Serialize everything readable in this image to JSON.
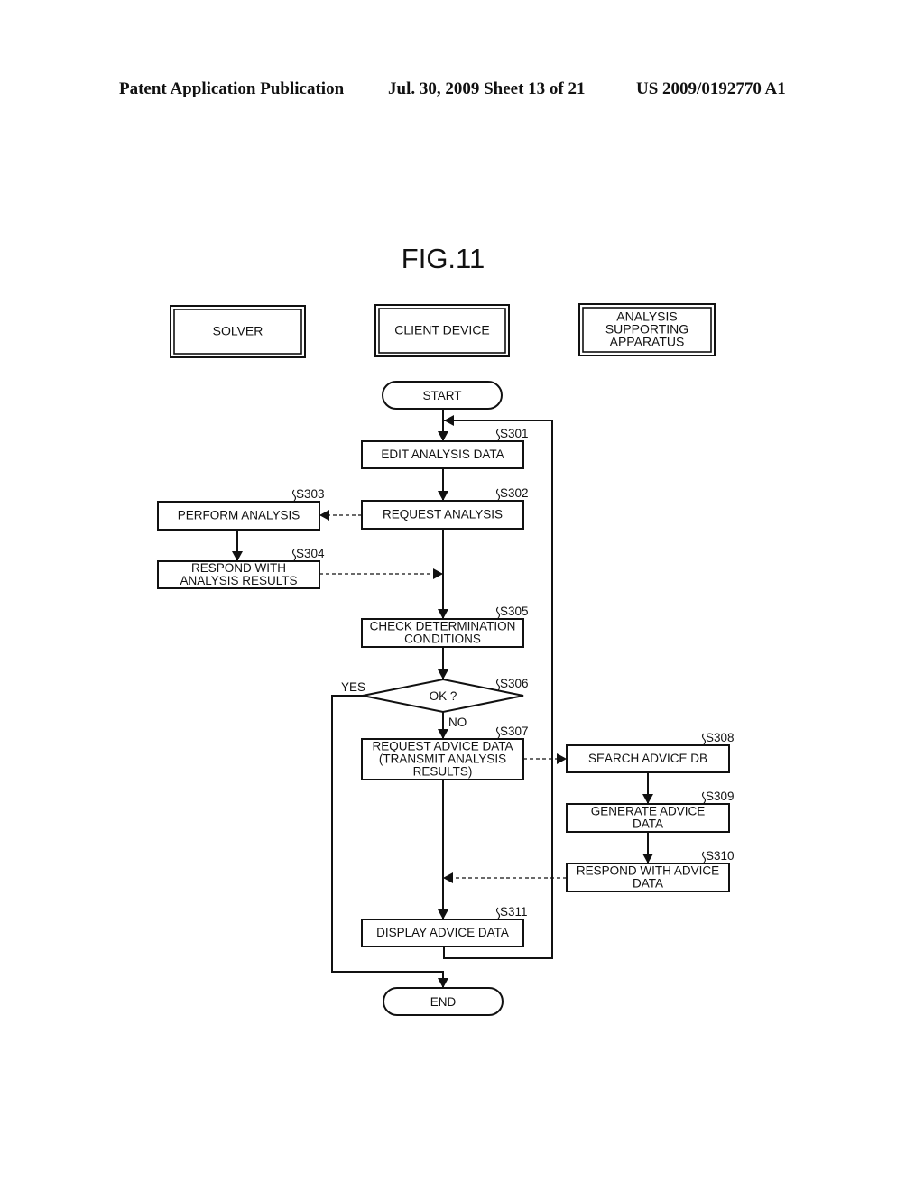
{
  "header": {
    "publication": "Patent Application Publication",
    "date_sheet": "Jul. 30, 2009   Sheet 13 of 21",
    "number": "US 2009/0192770 A1"
  },
  "figure": {
    "title": "FIG.11",
    "lanes": [
      {
        "id": "solver",
        "lines": [
          "SOLVER"
        ]
      },
      {
        "id": "client",
        "lines": [
          "CLIENT DEVICE"
        ]
      },
      {
        "id": "analysis",
        "lines": [
          "ANALYSIS",
          "SUPPORTING",
          "APPARATUS"
        ]
      }
    ],
    "terminals": {
      "start": "START",
      "end": "END"
    },
    "steps": [
      {
        "id": "S301",
        "label": "S301",
        "lines": [
          "EDIT ANALYSIS DATA"
        ]
      },
      {
        "id": "S302",
        "label": "S302",
        "lines": [
          "REQUEST ANALYSIS"
        ]
      },
      {
        "id": "S303",
        "label": "S303",
        "lines": [
          "PERFORM ANALYSIS"
        ]
      },
      {
        "id": "S304",
        "label": "S304",
        "lines": [
          "RESPOND WITH",
          "ANALYSIS RESULTS"
        ]
      },
      {
        "id": "S305",
        "label": "S305",
        "lines": [
          "CHECK DETERMINATION",
          "CONDITIONS"
        ]
      },
      {
        "id": "S306",
        "label": "S306",
        "lines": [
          "OK ?"
        ]
      },
      {
        "id": "S307",
        "label": "S307",
        "lines": [
          "REQUEST ADVICE DATA",
          "(TRANSMIT ANALYSIS",
          "RESULTS)"
        ]
      },
      {
        "id": "S308",
        "label": "S308",
        "lines": [
          "SEARCH ADVICE DB"
        ]
      },
      {
        "id": "S309",
        "label": "S309",
        "lines": [
          "GENERATE ADVICE",
          "DATA"
        ]
      },
      {
        "id": "S310",
        "label": "S310",
        "lines": [
          "RESPOND WITH ADVICE",
          "DATA"
        ]
      },
      {
        "id": "S311",
        "label": "S311",
        "lines": [
          "DISPLAY ADVICE DATA"
        ]
      }
    ],
    "branch_labels": {
      "yes": "YES",
      "no": "NO"
    }
  }
}
